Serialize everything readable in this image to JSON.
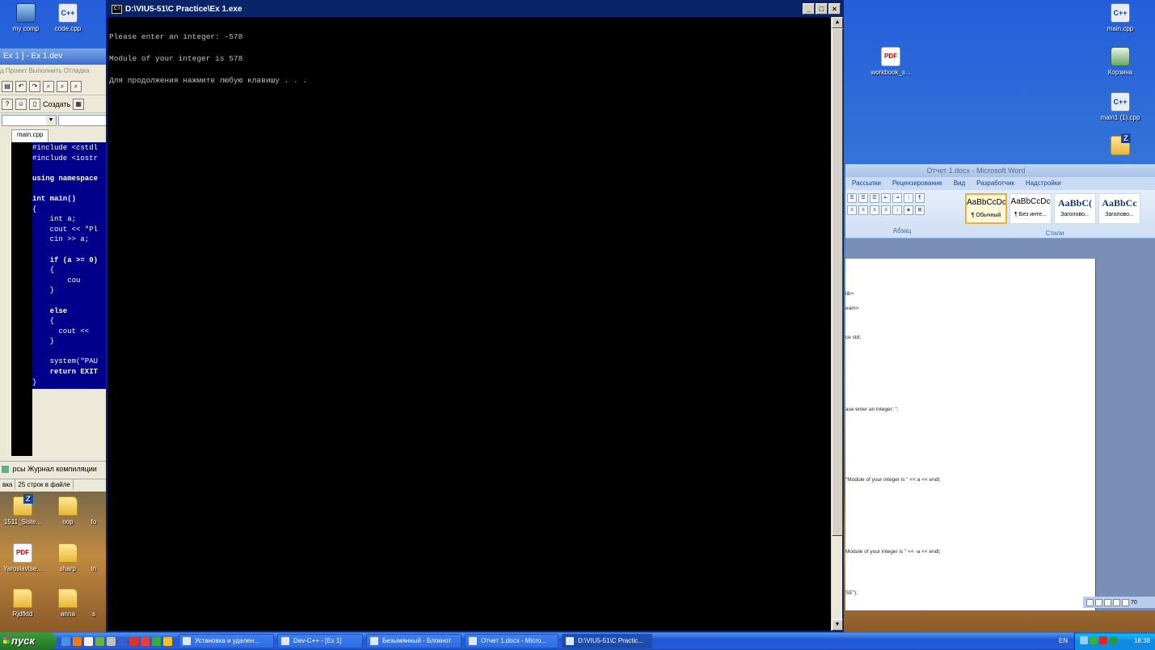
{
  "desktop": {
    "icons_top_left": [
      {
        "label": "my comp",
        "icon": "computer-icon"
      },
      {
        "label": "code.cpp",
        "icon": "cpp-file-icon"
      }
    ],
    "icons_right": [
      {
        "label": "main.cpp",
        "icon": "cpp-file-icon"
      },
      {
        "label": "Корзина",
        "icon": "recycle-bin-icon"
      },
      {
        "label": "main1 (1).cpp",
        "icon": "cpp-file-icon"
      },
      {
        "label": "",
        "icon": "zip-folder-icon"
      },
      {
        "label": "workbook_s...",
        "icon": "pdf-icon"
      }
    ],
    "icons_bottom_left": [
      {
        "label": "1511_Siste...",
        "icon": "zip-folder-icon"
      },
      {
        "label": "oop",
        "icon": "folder-icon"
      },
      {
        "label": "fo",
        "icon": "folder-icon"
      },
      {
        "label": "Yaroslavtse...",
        "icon": "pdf-icon"
      },
      {
        "label": "sharp",
        "icon": "folder-icon"
      },
      {
        "label": "in",
        "icon": "folder-icon"
      },
      {
        "label": "Rjdfktd",
        "icon": "folder-icon"
      },
      {
        "label": "anna",
        "icon": "folder-icon"
      },
      {
        "label": "s",
        "icon": "folder-icon"
      }
    ]
  },
  "devcpp": {
    "title": "Ex 1 ] - Ex 1.dev",
    "menu": "д  Проект  Выполнить  Отладка",
    "toolbar2_label": "Создать",
    "tab": "main.cpp",
    "code_lines": [
      "#include <cstdl",
      "#include <iostr",
      "",
      "using namespace",
      "",
      "int main()",
      "{",
      "    int a;",
      "    cout << \"Pl",
      "    cin >> a;",
      "",
      "    if (a >= 0)",
      "    {",
      "        cou",
      "    }",
      "",
      "    else",
      "    {",
      "      cout <<",
      "    }",
      "",
      "    system(\"PAU",
      "    return EXIT",
      "}"
    ],
    "bottom_tabs": "рсы  Журнал компиляции",
    "status_left": "вка",
    "status_right": "25 строк в файле"
  },
  "console": {
    "title": "D:\\VIU5-51\\C Practice\\Ex 1.exe",
    "lines": [
      "Please enter an integer: -578",
      "Module of your integer is 578",
      "Для продолжения нажмите любую клавишу . . ."
    ]
  },
  "word": {
    "title": "Отчет 1.docx - Microsoft Word",
    "tabs": [
      "Рассылки",
      "Рецензирование",
      "Вид",
      "Разработчик",
      "Надстройки"
    ],
    "paragraph_label": "Абзац",
    "styles_label": "Стили",
    "styles": [
      {
        "preview": "AaBbCcDc",
        "name": "¶ Обычный",
        "selected": true
      },
      {
        "preview": "AaBbCcDc",
        "name": "¶ Без инте...",
        "selected": false
      },
      {
        "preview": "AaBbC(",
        "name": "Заголово...",
        "selected": false
      },
      {
        "preview": "AaBbCc",
        "name": "Заголово...",
        "selected": false
      }
    ],
    "page_lines": [
      "lib>",
      "eam>",
      "ce std;",
      "ase enter an integer: \";",
      "\"Module of your integer is \" << a << endl;",
      "Module of your integer is \" << -a << endl;",
      "SE\");"
    ],
    "zoom": "70"
  },
  "taskbar": {
    "start_label": "пуск",
    "buttons": [
      {
        "label": "Установка и удален...",
        "active": false
      },
      {
        "label": "Dev-C++ - [Ex 1]",
        "active": false
      },
      {
        "label": "Безымянный - Блокнот",
        "active": false
      },
      {
        "label": "Отчет 1.docx - Micro...",
        "active": false
      },
      {
        "label": "D:\\VIU5-51\\C Practic...",
        "active": true
      }
    ],
    "lang": "EN",
    "clock": "18:38"
  }
}
